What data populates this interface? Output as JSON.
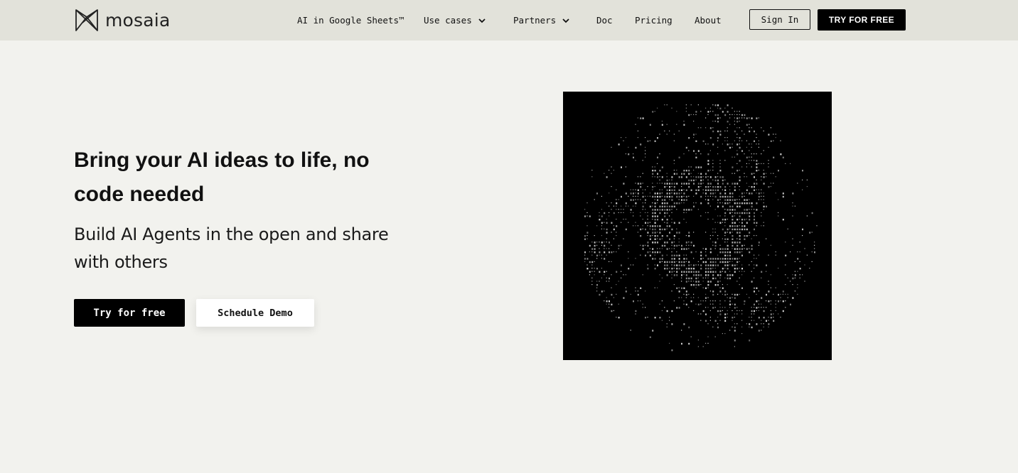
{
  "header": {
    "logo_text": "mosaia",
    "nav": [
      {
        "label": "AI in Google Sheets™",
        "has_dropdown": false
      },
      {
        "label": "Use cases",
        "has_dropdown": true
      },
      {
        "label": "Partners",
        "has_dropdown": true
      },
      {
        "label": "Doc",
        "has_dropdown": false
      },
      {
        "label": "Pricing",
        "has_dropdown": false
      },
      {
        "label": "About",
        "has_dropdown": false
      }
    ],
    "sign_in_label": "Sign In",
    "try_label": "TRY FOR FREE"
  },
  "hero": {
    "title": "Bring your AI ideas to life, no code needed",
    "subtitle": "Build AI Agents in the open and share with others",
    "primary_cta": "Try for free",
    "secondary_cta": "Schedule Demo"
  },
  "art": {
    "description_icon": "ascii-art-image",
    "background": "#000000",
    "glyph_color": "#d9d9d9"
  },
  "colors": {
    "page_bg": "#f2f2ee",
    "header_bg": "#e2e2da",
    "accent": "#000000"
  }
}
